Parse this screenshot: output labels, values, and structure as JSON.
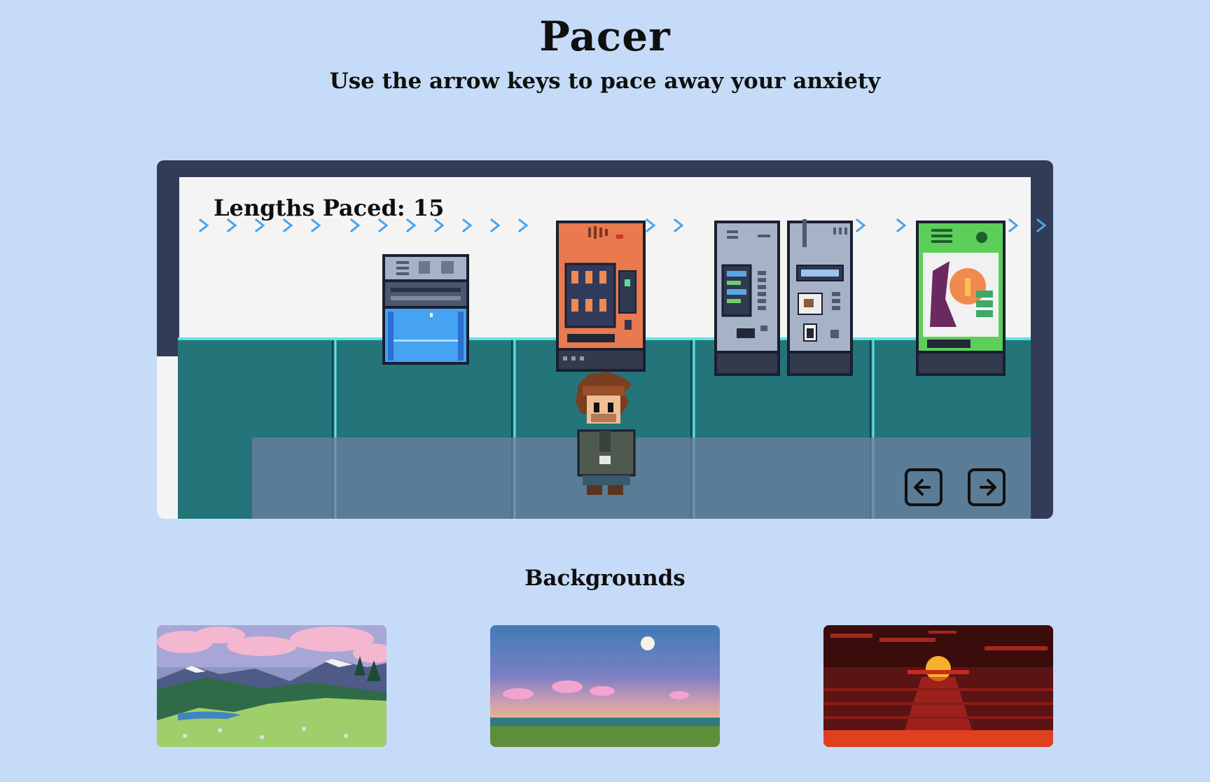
{
  "header": {
    "title": "Pacer",
    "subtitle": "Use the arrow keys to pace away your anxiety"
  },
  "game": {
    "counter_label": "Lengths Paced: 15",
    "lengths_paced": 15,
    "scene_objects": [
      "water-cooler-icon",
      "orange-vending-machine-icon",
      "gray-vending-machine-icon",
      "coffee-vending-machine-icon",
      "green-vending-machine-icon",
      "player-character-icon"
    ],
    "colors": {
      "frame": "#333c57",
      "wall": "#f4f4f4",
      "floor": "#23757a",
      "overlay": "#566a85",
      "chevrons": "#4aa3ef"
    }
  },
  "controls": {
    "left_icon": "arrow-left-icon",
    "right_icon": "arrow-right-icon"
  },
  "backgrounds": {
    "heading": "Backgrounds",
    "items": [
      {
        "icon": "mountain-meadow-thumbnail"
      },
      {
        "icon": "twilight-sky-thumbnail"
      },
      {
        "icon": "red-sunset-thumbnail"
      }
    ]
  },
  "theme": {
    "page_bg": "#c6dbf7",
    "text": "#0f0f0f"
  }
}
